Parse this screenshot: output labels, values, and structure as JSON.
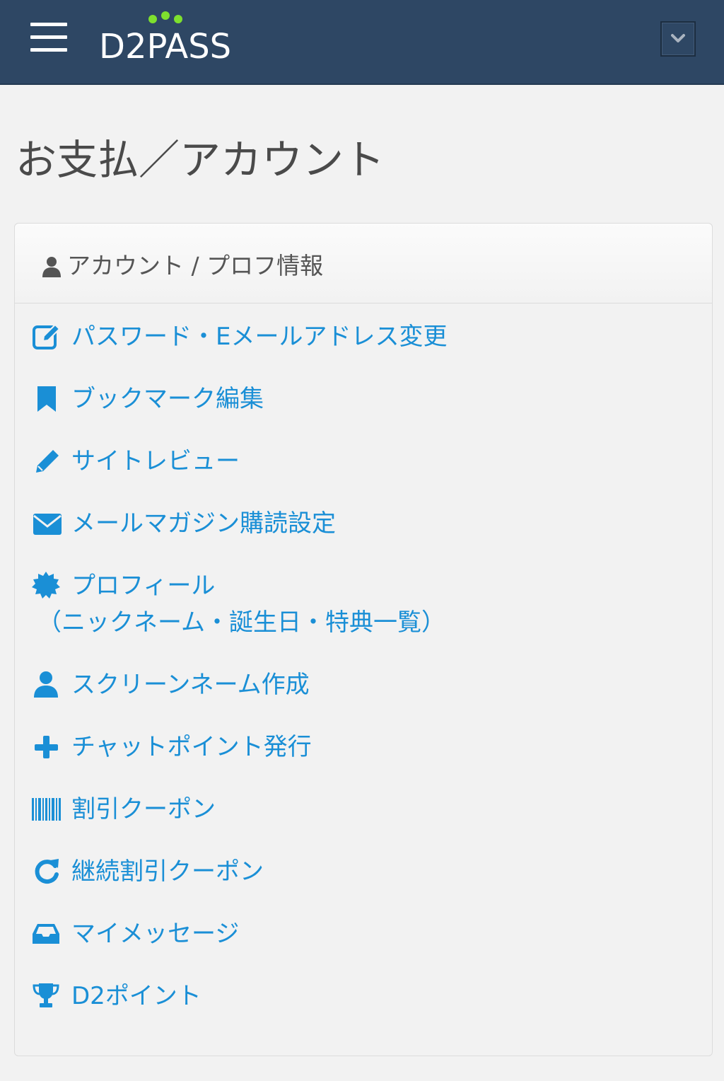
{
  "header": {
    "logo_text": "D2PASS",
    "menu_icon": "hamburger-menu-icon",
    "dropdown_icon": "chevron-down-icon",
    "bg_color": "#2e4764",
    "logo_dot_color": "#7ee02e"
  },
  "page": {
    "title": "お支払／アカウント"
  },
  "panel": {
    "heading": "アカウント / プロフ情報",
    "heading_icon": "user-icon",
    "link_color": "#1a8fd6",
    "items": [
      {
        "label": "パスワード・Eメールアドレス変更",
        "icon": "edit-icon"
      },
      {
        "label": "ブックマーク編集",
        "icon": "bookmark-icon"
      },
      {
        "label": "サイトレビュー",
        "icon": "pencil-icon"
      },
      {
        "label": "メールマガジン購読設定",
        "icon": "envelope-icon"
      },
      {
        "label": "プロフィール",
        "label2": "（ニックネーム・誕生日・特典一覧）",
        "icon": "certificate-icon"
      },
      {
        "label": "スクリーンネーム作成",
        "icon": "user-icon"
      },
      {
        "label": "チャットポイント発行",
        "icon": "plus-icon"
      },
      {
        "label": "割引クーポン",
        "icon": "barcode-icon"
      },
      {
        "label": "継続割引クーポン",
        "icon": "refresh-icon"
      },
      {
        "label": "マイメッセージ",
        "icon": "inbox-icon"
      },
      {
        "label": "D2ポイント",
        "icon": "trophy-icon"
      }
    ]
  }
}
